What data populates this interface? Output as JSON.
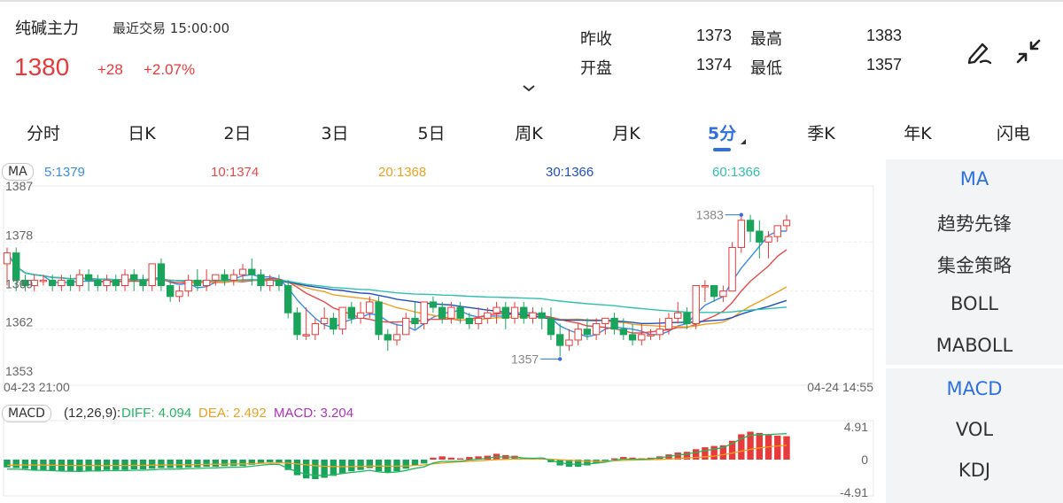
{
  "header": {
    "name": "纯碱主力",
    "trade_label": "最近交易",
    "trade_time": "15:00:00",
    "price": "1380",
    "change": "+28",
    "change_pct": "+2.07%",
    "quotes": [
      {
        "label": "昨收",
        "value": "1373"
      },
      {
        "label": "最高",
        "value": "1383"
      },
      {
        "label": "开盘",
        "value": "1374"
      },
      {
        "label": "最低",
        "value": "1357"
      }
    ],
    "icons": [
      "draw-icon",
      "collapse-icon"
    ]
  },
  "tabs": [
    "分时",
    "日K",
    "2日",
    "3日",
    "5日",
    "周K",
    "月K",
    "5分",
    "季K",
    "年K",
    "闪电"
  ],
  "active_tab": "5分",
  "ma_legend": {
    "tag": "MA",
    "items": [
      {
        "text": "5:1379",
        "color": "#3a8ee6"
      },
      {
        "text": "10:1374",
        "color": "#e84a4a"
      },
      {
        "text": "20:1368",
        "color": "#f0a020"
      },
      {
        "text": "30:1366",
        "color": "#2050c0"
      },
      {
        "text": "60:1366",
        "color": "#30c0b0"
      }
    ]
  },
  "macd_legend": {
    "tag": "MACD",
    "params": "(12,26,9):",
    "items": [
      {
        "text": "DIFF: 4.094",
        "color": "#20b860"
      },
      {
        "text": "DEA: 2.492",
        "color": "#f0a020"
      },
      {
        "text": "MACD: 3.204",
        "color": "#b030c0"
      }
    ]
  },
  "side_panel": {
    "main_items": [
      "MA",
      "趋势先锋",
      "集金策略",
      "BOLL",
      "MABOLL"
    ],
    "sub_items": [
      "MACD",
      "VOL",
      "KDJ"
    ],
    "main_active": "MA",
    "sub_active": "MACD"
  },
  "colors": {
    "up": "#e83a3a",
    "down": "#1aa35a",
    "accent": "#2f6fe0"
  },
  "chart_data": {
    "type": "candlestick",
    "y_ticks": [
      "1387",
      "1378",
      "1369",
      "1362",
      "1353"
    ],
    "y_range": [
      1353,
      1387
    ],
    "x_start": "04-23 21:00",
    "x_end": "04-24 14:55",
    "max_label": "1383",
    "min_label": "1357",
    "candles": [
      [
        1374,
        1376,
        1370,
        1377
      ],
      [
        1376,
        1371,
        1369,
        1377
      ],
      [
        1371,
        1370,
        1369,
        1372
      ],
      [
        1370,
        1371,
        1369,
        1372
      ],
      [
        1371,
        1371,
        1370,
        1372
      ],
      [
        1371,
        1370,
        1369,
        1372
      ],
      [
        1370,
        1371,
        1369,
        1372
      ],
      [
        1371,
        1370,
        1369,
        1372
      ],
      [
        1370,
        1372,
        1369,
        1373
      ],
      [
        1372,
        1371,
        1369,
        1373
      ],
      [
        1371,
        1370,
        1369,
        1372
      ],
      [
        1370,
        1371,
        1369,
        1372
      ],
      [
        1371,
        1370,
        1369,
        1372
      ],
      [
        1370,
        1372,
        1369,
        1373
      ],
      [
        1372,
        1371,
        1369,
        1373
      ],
      [
        1371,
        1370,
        1369,
        1372
      ],
      [
        1370,
        1374,
        1369,
        1374
      ],
      [
        1374,
        1370,
        1369,
        1375
      ],
      [
        1370,
        1368,
        1367,
        1371
      ],
      [
        1368,
        1369,
        1367,
        1370
      ],
      [
        1369,
        1371,
        1368,
        1372
      ],
      [
        1371,
        1370,
        1369,
        1373
      ],
      [
        1370,
        1371,
        1369,
        1373
      ],
      [
        1371,
        1372,
        1370,
        1372
      ],
      [
        1372,
        1371,
        1370,
        1373
      ],
      [
        1371,
        1372,
        1370,
        1373
      ],
      [
        1372,
        1373,
        1371,
        1374
      ],
      [
        1373,
        1372,
        1370,
        1375
      ],
      [
        1372,
        1370,
        1369,
        1373
      ],
      [
        1370,
        1371,
        1369,
        1372
      ],
      [
        1371,
        1370,
        1369,
        1372
      ],
      [
        1370,
        1365,
        1364,
        1371
      ],
      [
        1365,
        1361,
        1360,
        1366
      ],
      [
        1361,
        1361,
        1360,
        1366
      ],
      [
        1361,
        1363,
        1360,
        1364
      ],
      [
        1363,
        1364,
        1362,
        1366
      ],
      [
        1364,
        1362,
        1361,
        1365
      ],
      [
        1362,
        1366,
        1361,
        1366
      ],
      [
        1366,
        1364,
        1363,
        1367
      ],
      [
        1364,
        1365,
        1363,
        1367
      ],
      [
        1365,
        1367,
        1364,
        1368
      ],
      [
        1367,
        1361,
        1360,
        1368
      ],
      [
        1361,
        1360,
        1358,
        1362
      ],
      [
        1360,
        1361,
        1359,
        1363
      ],
      [
        1361,
        1364,
        1361,
        1365
      ],
      [
        1364,
        1363,
        1362,
        1367
      ],
      [
        1363,
        1367,
        1362,
        1367
      ],
      [
        1367,
        1366,
        1365,
        1368
      ],
      [
        1366,
        1364,
        1363,
        1367
      ],
      [
        1364,
        1366,
        1363,
        1367
      ],
      [
        1366,
        1364,
        1363,
        1367
      ],
      [
        1364,
        1363,
        1362,
        1365
      ],
      [
        1363,
        1364,
        1362,
        1366
      ],
      [
        1364,
        1365,
        1363,
        1366
      ],
      [
        1365,
        1366,
        1363,
        1367
      ],
      [
        1366,
        1364,
        1362,
        1367
      ],
      [
        1364,
        1366,
        1363,
        1367
      ],
      [
        1366,
        1364,
        1363,
        1367
      ],
      [
        1364,
        1365,
        1363,
        1366
      ],
      [
        1365,
        1364,
        1362,
        1366
      ],
      [
        1364,
        1361,
        1360,
        1366
      ],
      [
        1361,
        1359,
        1357,
        1363
      ],
      [
        1359,
        1360,
        1358,
        1362
      ],
      [
        1360,
        1362,
        1359,
        1363
      ],
      [
        1362,
        1361,
        1360,
        1364
      ],
      [
        1361,
        1363,
        1360,
        1364
      ],
      [
        1363,
        1364,
        1361,
        1364
      ],
      [
        1364,
        1362,
        1361,
        1365
      ],
      [
        1362,
        1361,
        1360,
        1364
      ],
      [
        1361,
        1360,
        1359,
        1363
      ],
      [
        1360,
        1361,
        1359,
        1363
      ],
      [
        1361,
        1361,
        1360,
        1362
      ],
      [
        1361,
        1362,
        1360,
        1364
      ],
      [
        1362,
        1364,
        1361,
        1365
      ],
      [
        1364,
        1365,
        1363,
        1367
      ],
      [
        1365,
        1363,
        1362,
        1366
      ],
      [
        1363,
        1370,
        1362,
        1370
      ],
      [
        1370,
        1370,
        1367,
        1371
      ],
      [
        1370,
        1368,
        1367,
        1370
      ],
      [
        1368,
        1369,
        1367,
        1370
      ],
      [
        1369,
        1377,
        1369,
        1378
      ],
      [
        1377,
        1382,
        1376,
        1383
      ],
      [
        1382,
        1380,
        1378,
        1383
      ],
      [
        1380,
        1378,
        1375,
        1382
      ],
      [
        1378,
        1379,
        1375,
        1380
      ],
      [
        1379,
        1381,
        1378,
        1381
      ],
      [
        1381,
        1382,
        1380,
        1383
      ]
    ],
    "ma_colors": [
      "#3a8ee6",
      "#e84a4a",
      "#f0a020",
      "#2050c0",
      "#30c0b0"
    ],
    "macd": {
      "y_ticks": [
        "4.91",
        "0",
        "-4.91"
      ],
      "y_range": [
        -4.91,
        4.91
      ],
      "hist": [
        -1.2,
        -1.3,
        -1.4,
        -1.6,
        -1.6,
        -1.7,
        -1.8,
        -1.8,
        -1.8,
        -1.7,
        -1.7,
        -1.6,
        -1.6,
        -1.6,
        -1.5,
        -1.5,
        -1.4,
        -1.3,
        -1.3,
        -1.3,
        -1.2,
        -1.2,
        -1.1,
        -1.1,
        -1.0,
        -1.0,
        -1.0,
        -0.8,
        -0.6,
        -0.4,
        -0.5,
        -1.6,
        -2.4,
        -2.9,
        -3.0,
        -2.8,
        -2.5,
        -2.1,
        -1.8,
        -1.6,
        -1.3,
        -1.8,
        -2.0,
        -1.8,
        -1.4,
        -0.9,
        -0.6,
        0.3,
        0.5,
        0.3,
        0.2,
        0.4,
        0.5,
        0.6,
        0.9,
        0.7,
        0.6,
        0.3,
        0.2,
        0.3,
        -0.4,
        -0.9,
        -1.1,
        -1.1,
        -0.9,
        -0.6,
        -0.3,
        0.2,
        0.4,
        0.3,
        0.2,
        0.3,
        0.5,
        0.8,
        1.1,
        1.2,
        1.6,
        1.9,
        2.1,
        2.2,
        2.9,
        3.9,
        4.3,
        4.1,
        3.8,
        3.7,
        3.6
      ]
    }
  }
}
